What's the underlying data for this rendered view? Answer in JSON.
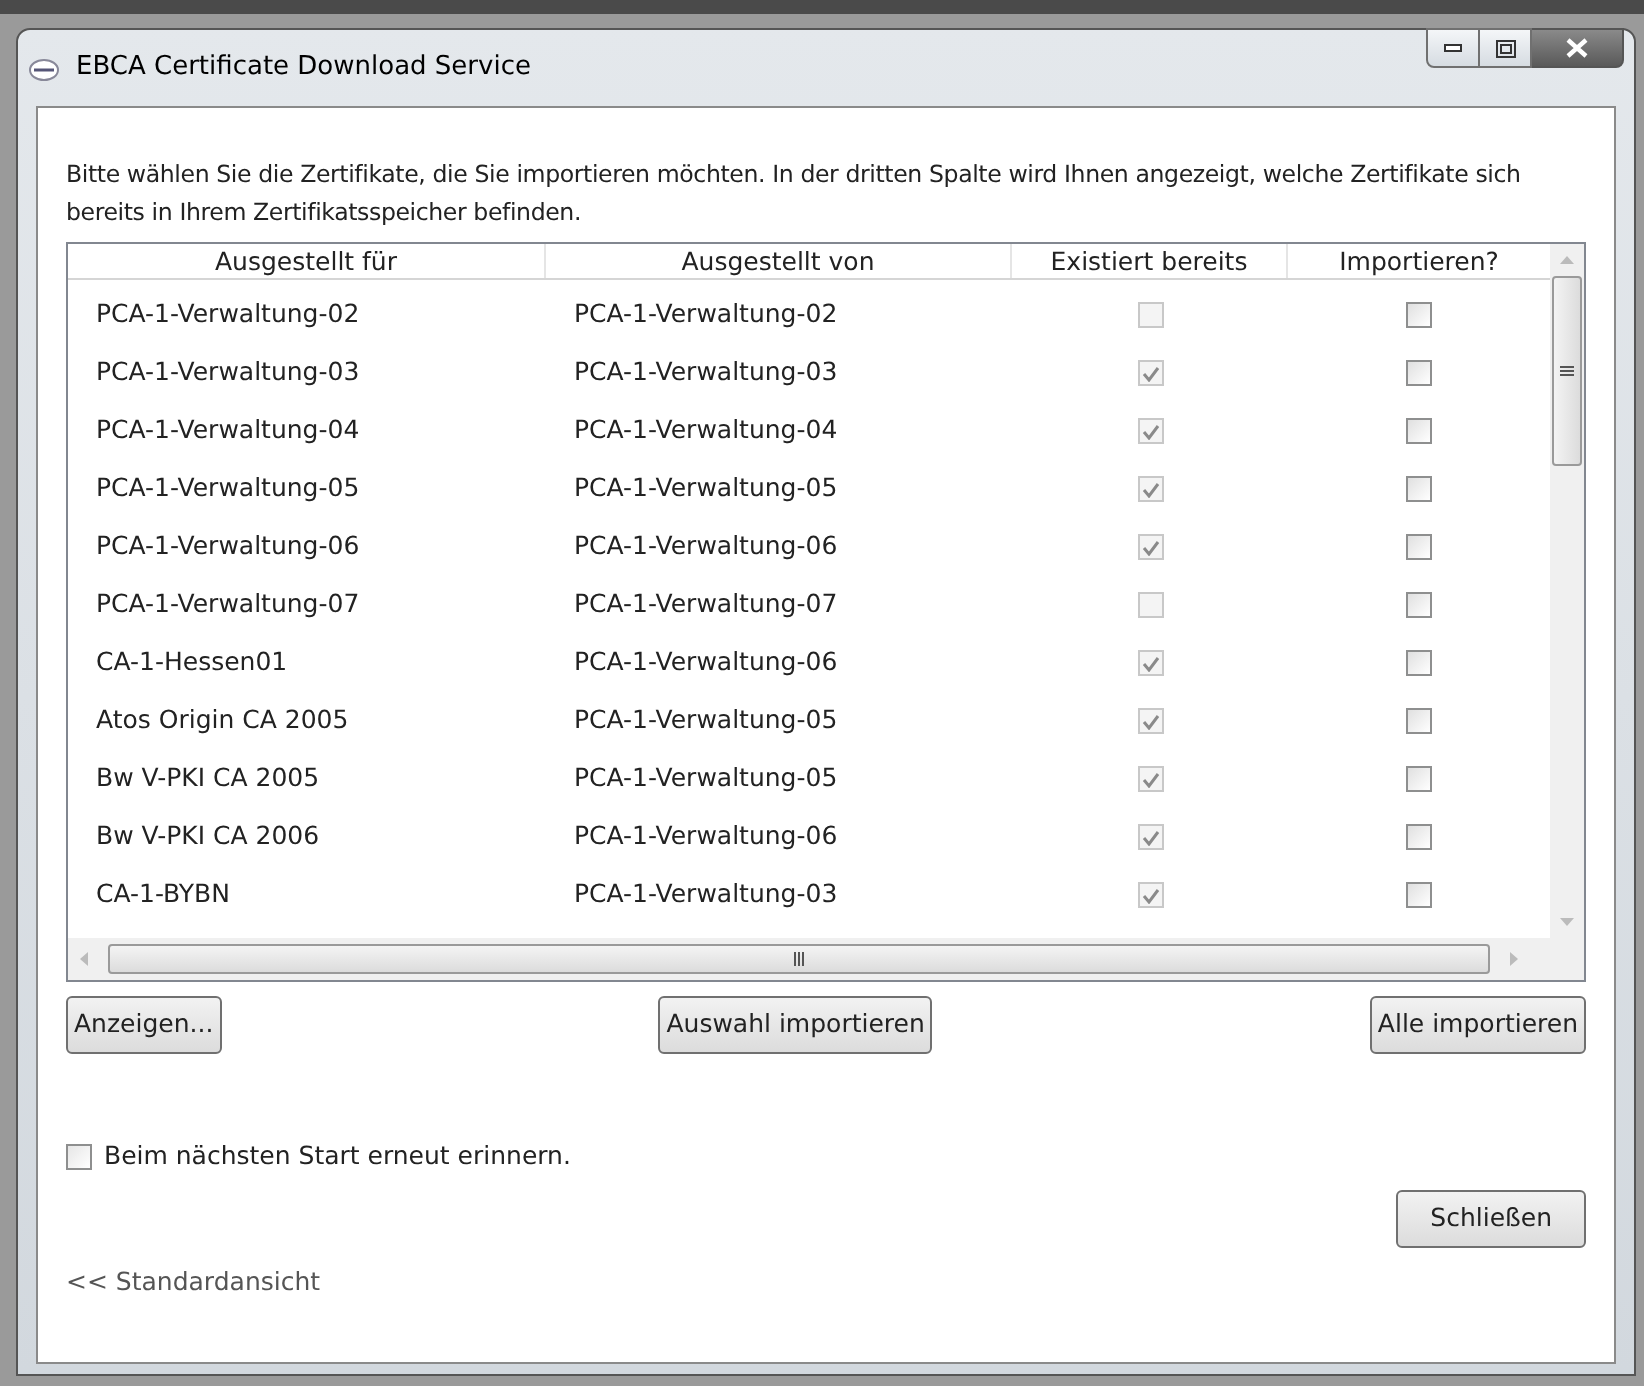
{
  "window": {
    "title": "EBCA Certificate Download Service"
  },
  "instructions": "Bitte wählen Sie die Zertifikate, die Sie importieren möchten. In der dritten Spalte wird Ihnen angezeigt, welche Zertifikate sich bereits in Ihrem Zertifikatsspeicher befinden.",
  "table": {
    "columns": [
      "Ausgestellt für",
      "Ausgestellt von",
      "Existiert bereits",
      "Importieren?"
    ],
    "rows": [
      {
        "issued_to": "PCA-1-Verwaltung-02",
        "issued_by": "PCA-1-Verwaltung-02",
        "exists": false,
        "import": false
      },
      {
        "issued_to": "PCA-1-Verwaltung-03",
        "issued_by": "PCA-1-Verwaltung-03",
        "exists": true,
        "import": false
      },
      {
        "issued_to": "PCA-1-Verwaltung-04",
        "issued_by": "PCA-1-Verwaltung-04",
        "exists": true,
        "import": false
      },
      {
        "issued_to": "PCA-1-Verwaltung-05",
        "issued_by": "PCA-1-Verwaltung-05",
        "exists": true,
        "import": false
      },
      {
        "issued_to": "PCA-1-Verwaltung-06",
        "issued_by": "PCA-1-Verwaltung-06",
        "exists": true,
        "import": false
      },
      {
        "issued_to": "PCA-1-Verwaltung-07",
        "issued_by": "PCA-1-Verwaltung-07",
        "exists": false,
        "import": false
      },
      {
        "issued_to": "CA-1-Hessen01",
        "issued_by": "PCA-1-Verwaltung-06",
        "exists": true,
        "import": false
      },
      {
        "issued_to": "Atos Origin CA 2005",
        "issued_by": "PCA-1-Verwaltung-05",
        "exists": true,
        "import": false
      },
      {
        "issued_to": "Bw V-PKI CA 2005",
        "issued_by": "PCA-1-Verwaltung-05",
        "exists": true,
        "import": false
      },
      {
        "issued_to": "Bw V-PKI CA 2006",
        "issued_by": "PCA-1-Verwaltung-06",
        "exists": true,
        "import": false
      },
      {
        "issued_to": "CA-1-BYBN",
        "issued_by": "PCA-1-Verwaltung-03",
        "exists": true,
        "import": false
      }
    ]
  },
  "buttons": [
    "Anzeigen...",
    "Auswahl importieren",
    "Alle importieren"
  ],
  "remind": {
    "label": "Beim nächsten Start erneut erinnern.",
    "checked": false
  },
  "close_button": "Schließen",
  "view_link": "<< Standardansicht"
}
